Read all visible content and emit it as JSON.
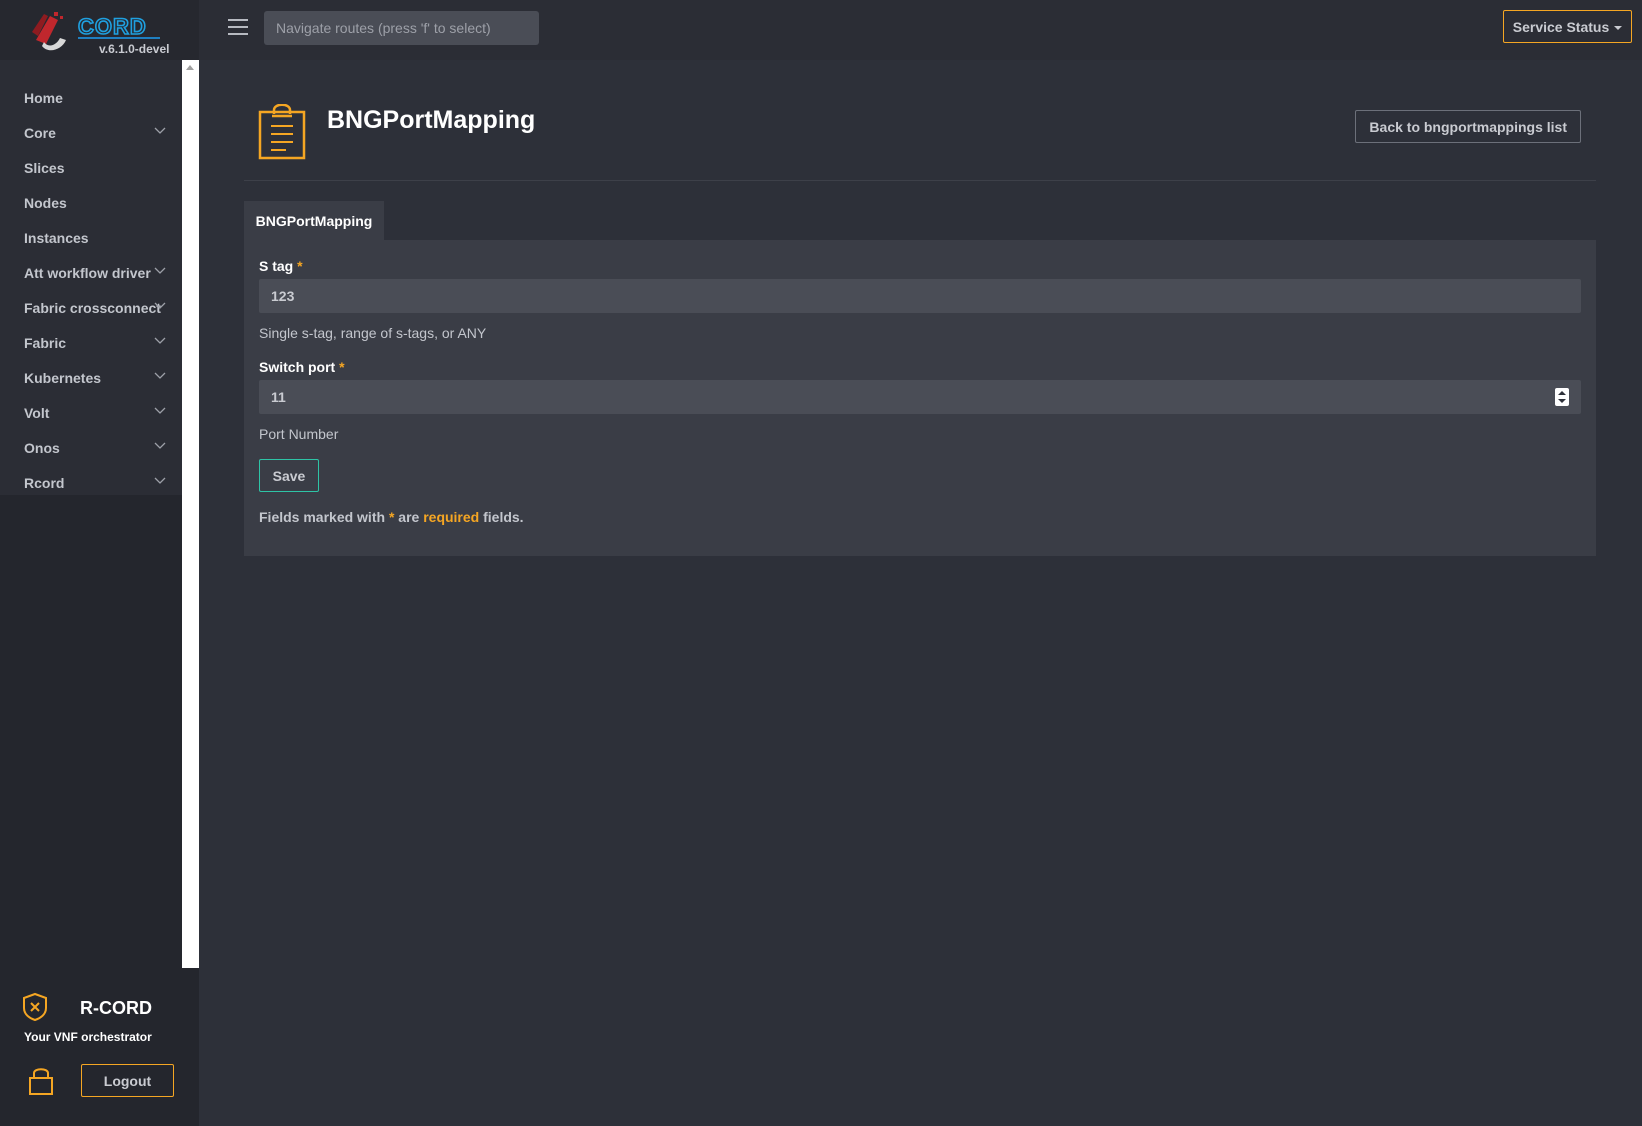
{
  "app": {
    "logo_text": "CORD",
    "version": "v.6.1.0-devel",
    "brand_name": "R-CORD",
    "brand_tagline": "Your VNF orchestrator",
    "accent_color": "#f5a623"
  },
  "topbar": {
    "search_placeholder": "Navigate routes (press 'f' to select)",
    "service_status_label": "Service Status"
  },
  "sidebar": {
    "items": [
      {
        "label": "Home",
        "has_submenu": false
      },
      {
        "label": "Core",
        "has_submenu": true
      },
      {
        "label": "Slices",
        "has_submenu": false
      },
      {
        "label": "Nodes",
        "has_submenu": false
      },
      {
        "label": "Instances",
        "has_submenu": false
      },
      {
        "label": "Att workflow driver",
        "has_submenu": true
      },
      {
        "label": "Fabric crossconnect",
        "has_submenu": true
      },
      {
        "label": "Fabric",
        "has_submenu": true
      },
      {
        "label": "Kubernetes",
        "has_submenu": true
      },
      {
        "label": "Volt",
        "has_submenu": true
      },
      {
        "label": "Onos",
        "has_submenu": true
      },
      {
        "label": "Rcord",
        "has_submenu": true
      }
    ],
    "logout_label": "Logout"
  },
  "main": {
    "title": "BNGPortMapping",
    "back_button_label": "Back to bngportmappings list",
    "tab_label": "BNGPortMapping",
    "form": {
      "fields": [
        {
          "label": "S tag",
          "required_mark": "*",
          "value": "123",
          "help": "Single s-tag, range of s-tags, or ANY"
        },
        {
          "label": "Switch port",
          "required_mark": "*",
          "value": "11",
          "help": "Port Number"
        }
      ],
      "save_label": "Save",
      "note": {
        "prefix": "Fields marked with ",
        "star": "*",
        "mid": " are ",
        "required_word": "required",
        "suffix": " fields."
      }
    }
  }
}
